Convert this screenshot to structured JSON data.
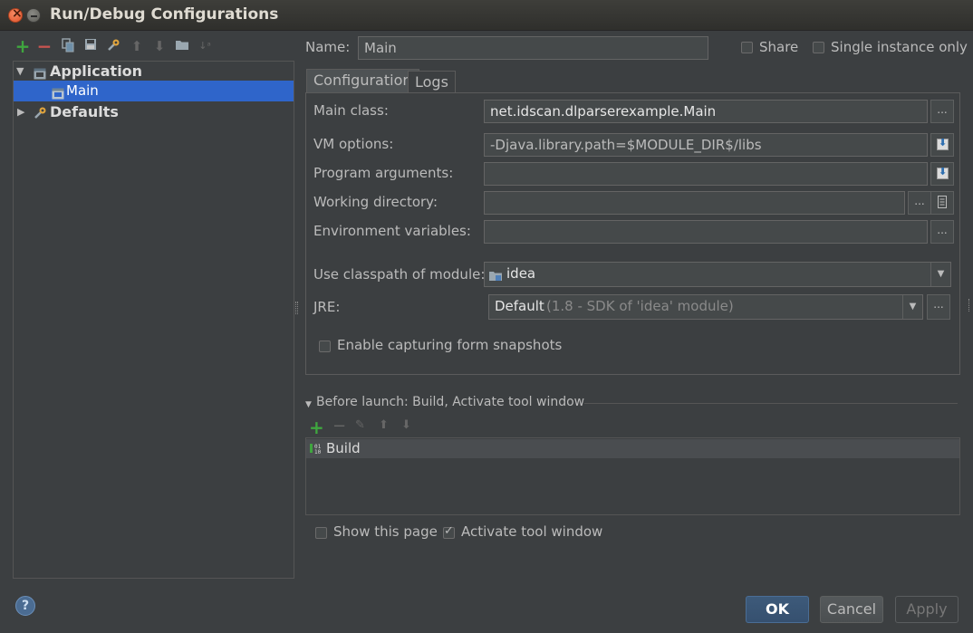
{
  "window": {
    "title": "Run/Debug Configurations"
  },
  "tree": {
    "application_label": "Application",
    "main_label": "Main",
    "defaults_label": "Defaults"
  },
  "header": {
    "name_label": "Name:",
    "name_value": "Main",
    "share_label": "Share",
    "single_instance_label": "Single instance only"
  },
  "tabs": [
    {
      "label": "Configuration",
      "active": true
    },
    {
      "label": "Logs",
      "active": false
    }
  ],
  "config": {
    "main_class_label": "Main class:",
    "main_class_value": "net.idscan.dlparserexample.Main",
    "vm_options_label": "VM options:",
    "vm_options_value": "-Djava.library.path=$MODULE_DIR$/libs",
    "program_args_label": "Program arguments:",
    "program_args_value": "",
    "working_dir_label": "Working directory:",
    "working_dir_value": "",
    "env_vars_label": "Environment variables:",
    "env_vars_value": "",
    "classpath_label": "Use classpath of module:",
    "classpath_value": "idea",
    "jre_label": "JRE:",
    "jre_value": "Default",
    "jre_hint": "(1.8 - SDK of 'idea' module)",
    "capture_label": "Enable capturing form snapshots",
    "ellipsis": "..."
  },
  "before_launch": {
    "title": "Before launch: Build, Activate tool window",
    "items": [
      "Build"
    ]
  },
  "bottom_options": {
    "show_page_label": "Show this page",
    "activate_tool_label": "Activate tool window",
    "activate_tool_checked": true
  },
  "buttons": {
    "ok": "OK",
    "cancel": "Cancel",
    "apply": "Apply",
    "help": "?"
  },
  "colors": {
    "background": "#3c3f41",
    "selection": "#2f65ca",
    "add_green": "#3fa63f",
    "remove_red": "#c75450"
  }
}
